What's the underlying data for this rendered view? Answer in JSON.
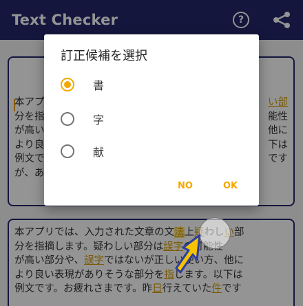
{
  "app": {
    "title": "Text Checker"
  },
  "toolbar": {
    "help_label": "?"
  },
  "card1": {
    "lines": [
      "本アプリ",
      "分を指",
      "が高い",
      "より良",
      "例文で",
      "が、あ"
    ],
    "right": [
      "い部",
      "能性",
      "他に",
      "下は",
      "です",
      ""
    ]
  },
  "card2": {
    "l1a": "本アプリでは、入力された文章の",
    "l1b": "文",
    "l1c": "法",
    "l1d": "上",
    "l1e": "疑",
    "l1f": "わし",
    "l1g": "い",
    "l1h": "部",
    "l2a": "分を指摘します。疑わしい部分は",
    "l2b": "誤字",
    "l2c": "の可能性",
    "l3a": "が高い部分や、",
    "l3b": "誤字",
    "l3c": "ではないが",
    "l3d": "正しい使い方、他に",
    "l4a": "より良い表現がありそうな部分を",
    "l4b": "指",
    "l4c": "します。以下は",
    "l5a": "例文です。お疲れさまです。昨",
    "l5b": "日",
    "l5c": "行えていた",
    "l5d": "件",
    "l5e": "です"
  },
  "dialog": {
    "title": "訂正候補を選択",
    "options": [
      {
        "label": "書",
        "selected": true
      },
      {
        "label": "字",
        "selected": false
      },
      {
        "label": "献",
        "selected": false
      }
    ],
    "negative": "NO",
    "positive": "OK"
  },
  "colors": {
    "appbar": "#232769",
    "accent": "#f5a800"
  }
}
